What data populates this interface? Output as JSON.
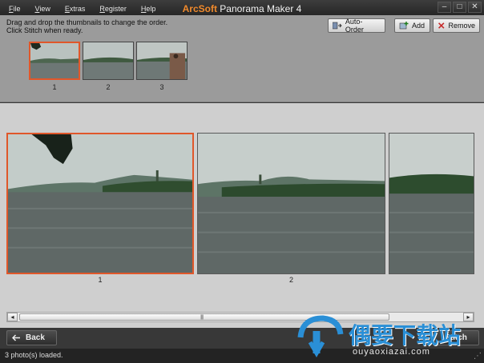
{
  "menu": {
    "items": [
      {
        "label": "File",
        "u": "F",
        "rest": "ile"
      },
      {
        "label": "View",
        "u": "V",
        "rest": "iew"
      },
      {
        "label": "Extras",
        "u": "E",
        "rest": "xtras"
      },
      {
        "label": "Register",
        "u": "R",
        "rest": "egister"
      },
      {
        "label": "Help",
        "u": "H",
        "rest": "elp"
      }
    ]
  },
  "title": {
    "brand": "ArcSoft",
    "rest": " Panorama Maker 4"
  },
  "window_buttons": {
    "minimize": "–",
    "maximize": "□",
    "close": "✕"
  },
  "instructions": {
    "line1": "Drag and drop the thumbnails to change the order.",
    "line2": "Click Stitch when ready."
  },
  "toolbar": {
    "auto_order_label": "Auto-Order",
    "add_label": "Add",
    "remove_label": "Remove"
  },
  "thumbnails": [
    {
      "number": "1",
      "selected": true
    },
    {
      "number": "2",
      "selected": false
    },
    {
      "number": "3",
      "selected": false
    }
  ],
  "photos": [
    {
      "number": "1",
      "selected": true
    },
    {
      "number": "2",
      "selected": false
    }
  ],
  "scrollbar": {
    "left_arrow": "◂",
    "right_arrow": "▸",
    "grip": "||||||"
  },
  "bottom": {
    "back_label": "Back",
    "stitch_label": "Stitch"
  },
  "status": {
    "text": "3 photo(s) loaded."
  },
  "watermark": {
    "text": "偶要下载站",
    "url_text": "ouyaoxiazai.com"
  },
  "colors": {
    "accent": "#e0572a",
    "brand": "#f08a2c",
    "watermark": "#2a8fd6"
  }
}
